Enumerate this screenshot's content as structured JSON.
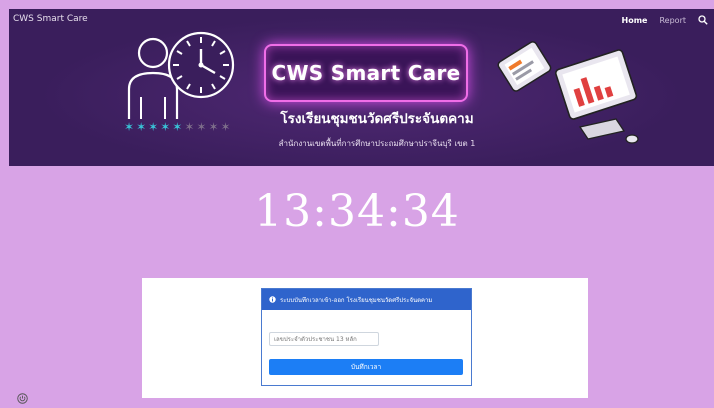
{
  "navbar": {
    "brand": "CWS Smart Care",
    "home_label": "Home",
    "report_label": "Report"
  },
  "banner": {
    "logo_text": "CWS Smart Care",
    "school_name": "โรงเรียนชุมชนวัดศรีประจันตคาม",
    "office_name": "สำนักงานเขตพื้นที่การศึกษาประถมศึกษาปราจีนบุรี เขต 1"
  },
  "clock": {
    "time": "13:34:34"
  },
  "checkin": {
    "panel_title": "ระบบบันทึกเวลาเข้า-ออก โรงเรียนชุมชนวัดศรีประจันตคาม",
    "id_placeholder": "เลขประจำตัวประชาชน 13 หลัก",
    "save_label": "บันทึกเวลา"
  },
  "colors": {
    "page_bg": "#d8a3e6",
    "banner_bg": "#3a1e5c",
    "panel_header": "#2f64cc",
    "button": "#1c7ef5"
  }
}
